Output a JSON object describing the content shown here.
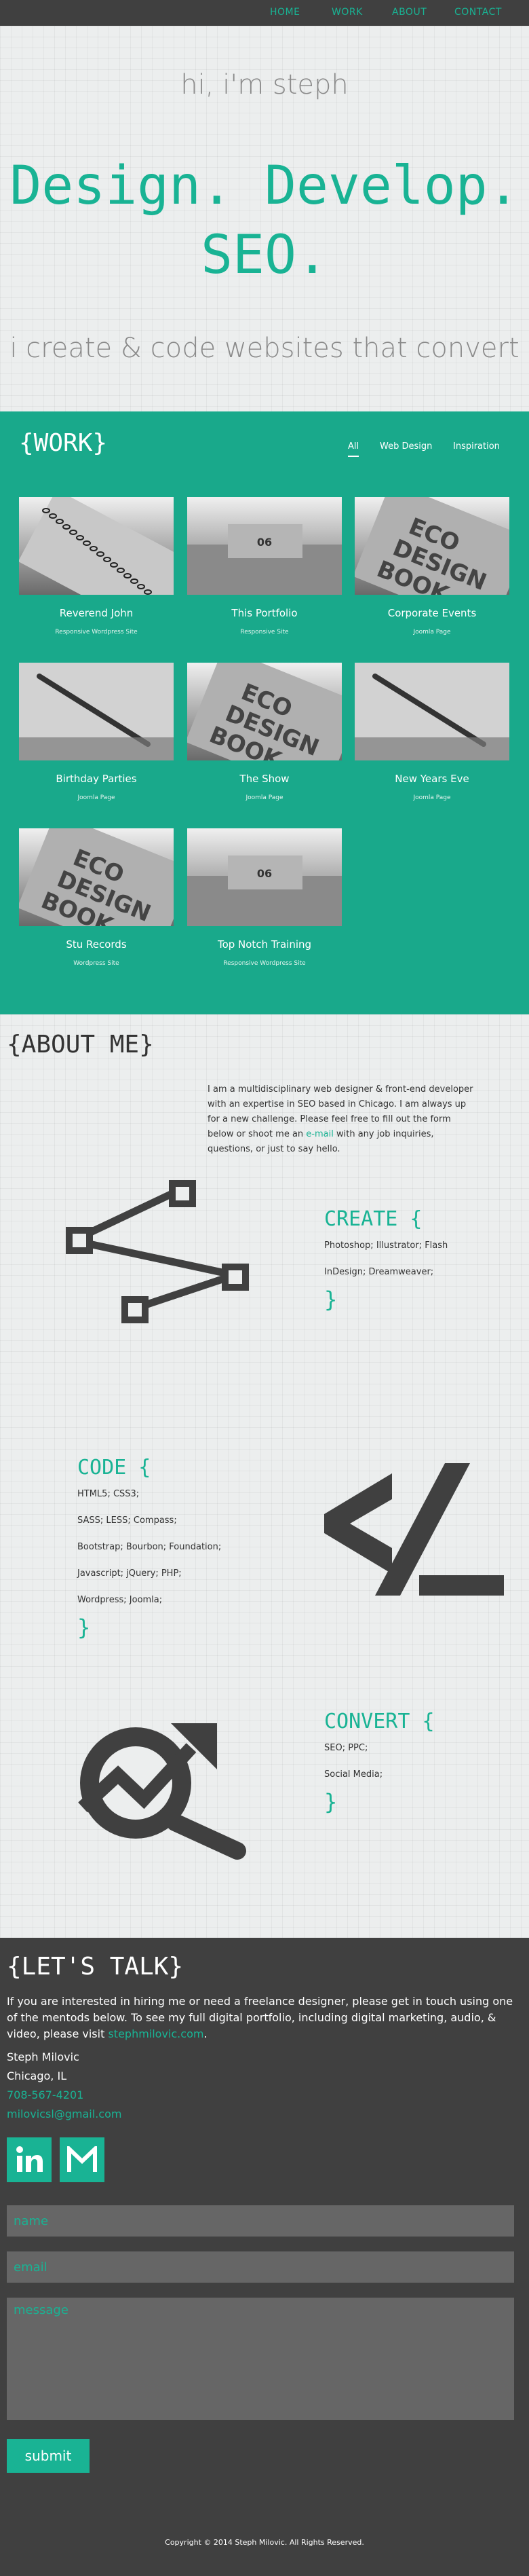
{
  "nav": {
    "home": "HOME",
    "work": "WORK",
    "about": "ABOUT",
    "contact": "CONTACT"
  },
  "hero": {
    "greeting": "hi, i'm steph",
    "headline_1": "Design. Develop.",
    "headline_2": "SEO.",
    "tagline": "i create & code websites that convert"
  },
  "work": {
    "title": "{WORK}",
    "filters": [
      "All",
      "Web Design",
      "Inspiration"
    ],
    "items": [
      {
        "name": "Reverend John",
        "type": "Responsive Wordpress Site",
        "image": "spiral-notebook"
      },
      {
        "name": "This Portfolio",
        "type": "Responsive Site",
        "image": "notebook-closeup"
      },
      {
        "name": "Corporate Events",
        "type": "Joomla Page",
        "image": "eco-design-book"
      },
      {
        "name": "Birthday Parties",
        "type": "Joomla Page",
        "image": "pen-on-paper"
      },
      {
        "name": "The Show",
        "type": "Joomla Page",
        "image": "eco-design-book"
      },
      {
        "name": "New Years Eve",
        "type": "Joomla Page",
        "image": "pen-on-paper"
      },
      {
        "name": "Stu Records",
        "type": "Wordpress Site",
        "image": "eco-design-book"
      },
      {
        "name": "Top Notch Training",
        "type": "Responsive Wordpress Site",
        "image": "notebook-closeup"
      }
    ]
  },
  "about": {
    "title": "{ABOUT ME}",
    "bio_before": "I am a multidisciplinary web designer & front-end developer with an expertise in SEO based in Chicago. I am always up for a new challenge. Please feel free to fill out the form below or shoot me an ",
    "bio_link": "e-mail",
    "bio_after": " with any job inquiries, questions, or just to say hello.",
    "create": {
      "title": "CREATE {",
      "lines": [
        "Photoshop; Illustrator; Flash",
        "InDesign; Dreamweaver;"
      ],
      "close": "}"
    },
    "code": {
      "title": "CODE {",
      "lines": [
        "HTML5; CSS3;",
        "SASS; LESS; Compass;",
        "Bootstrap; Bourbon; Foundation;",
        "Javascript; jQuery; PHP;",
        "Wordpress; Joomla;"
      ],
      "close": "}"
    },
    "convert": {
      "title": "CONVERT {",
      "lines": [
        "SEO; PPC;",
        "Social Media;"
      ],
      "close": "}"
    }
  },
  "talk": {
    "title": "{LET'S TALK}",
    "intro_before": "If you are interested in hiring me or need a freelance designer, please get in touch using one of the mentods below. To see my full digital portfolio, including digital marketing, audio, & video, please visit ",
    "intro_link": "stephmilovic.com",
    "intro_after": ".",
    "name": "Steph Milovic",
    "location": "Chicago, IL",
    "phone": "708-567-4201",
    "email": "milovicsl@gmail.com",
    "form": {
      "name_placeholder": "name",
      "email_placeholder": "email",
      "message_placeholder": "message",
      "submit": "submit"
    },
    "copyright": "Copyright © 2014 Steph Milovic. All Rights Reserved."
  },
  "colors": {
    "accent": "#19b394",
    "dark": "#404040",
    "work_bg": "#19a98b",
    "light_bg": "#eceeee"
  }
}
